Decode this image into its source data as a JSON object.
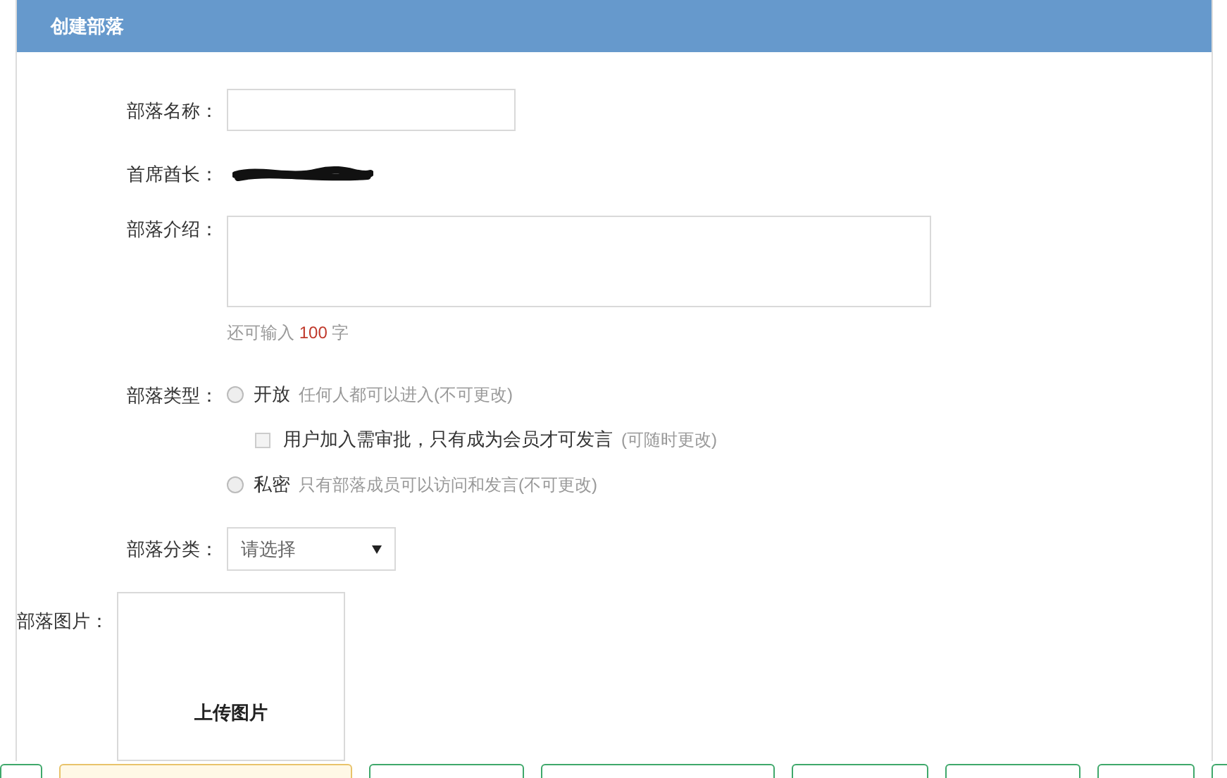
{
  "panel": {
    "title": "创建部落"
  },
  "fields": {
    "name": {
      "label": "部落名称："
    },
    "chief": {
      "label": "首席酋长："
    },
    "intro": {
      "label": "部落介绍：",
      "counter": {
        "prefix": "还可输入",
        "count": "100",
        "suffix": "字"
      }
    },
    "type": {
      "label": "部落类型：",
      "options": [
        {
          "kind": "radio",
          "label": "开放",
          "hint": "任何人都可以进入(不可更改)",
          "selected": false
        },
        {
          "kind": "checkbox",
          "label": "用户加入需审批，只有成为会员才可发言",
          "hint": "(可随时更改)",
          "checked": false
        },
        {
          "kind": "radio",
          "label": "私密",
          "hint": "只有部落成员可以访问和发言(不可更改)",
          "selected": false
        }
      ]
    },
    "category": {
      "label": "部落分类：",
      "value": "请选择"
    },
    "image": {
      "label": "部落图片：",
      "upload": "上传图片"
    }
  },
  "bottom_tabs": [
    {
      "selected": false
    },
    {
      "selected": true
    },
    {
      "selected": false
    },
    {
      "selected": false
    },
    {
      "selected": false
    },
    {
      "selected": false
    },
    {
      "selected": false
    },
    {
      "selected": false
    }
  ]
}
